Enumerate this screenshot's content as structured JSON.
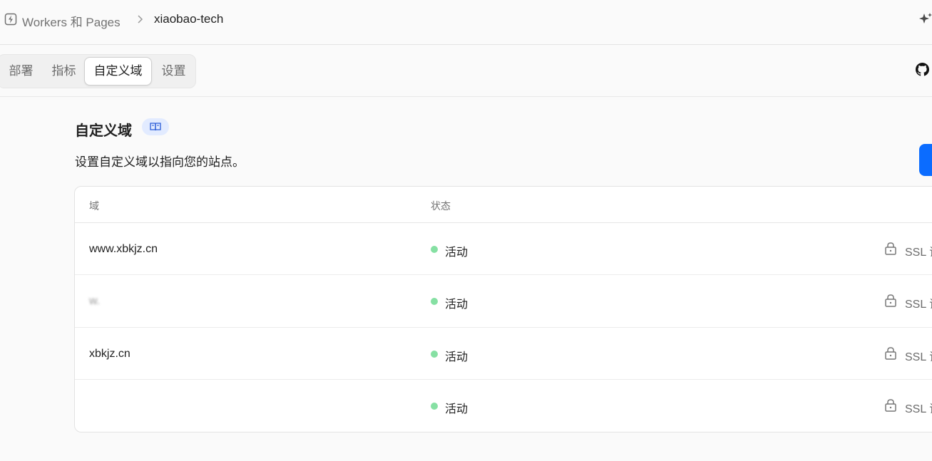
{
  "breadcrumb": {
    "root": "Workers 和 Pages",
    "current": "xiaobao-tech"
  },
  "tabs": [
    {
      "label": "部署",
      "active": false
    },
    {
      "label": "指标",
      "active": false
    },
    {
      "label": "自定义域",
      "active": true
    },
    {
      "label": "设置",
      "active": false
    }
  ],
  "page": {
    "title": "自定义域",
    "subtitle": "设置自定义域以指向您的站点。"
  },
  "table": {
    "columns": [
      "域",
      "状态"
    ],
    "rows": [
      {
        "domain": "www.xbkjz.cn",
        "status": "活动",
        "ssl": "SSL 证",
        "blurred": false
      },
      {
        "domain": "w.",
        "status": "活动",
        "ssl": "SSL 证",
        "blurred": true
      },
      {
        "domain": "xbkjz.cn",
        "status": "活动",
        "ssl": "SSL 证",
        "blurred": false
      },
      {
        "domain": "",
        "status": "活动",
        "ssl": "SSL 证",
        "blurred": true
      }
    ]
  },
  "colors": {
    "accent": "#0b6cff",
    "status_active": "#86e0a3",
    "badge_bg": "#e2ebff"
  },
  "icons": {
    "breadcrumb": "workers-bolt-icon",
    "separator": "chevron-right-icon",
    "ai": "sparkle-icon",
    "repo": "github-icon",
    "docs": "book-open-icon",
    "ssl": "lock-icon"
  }
}
